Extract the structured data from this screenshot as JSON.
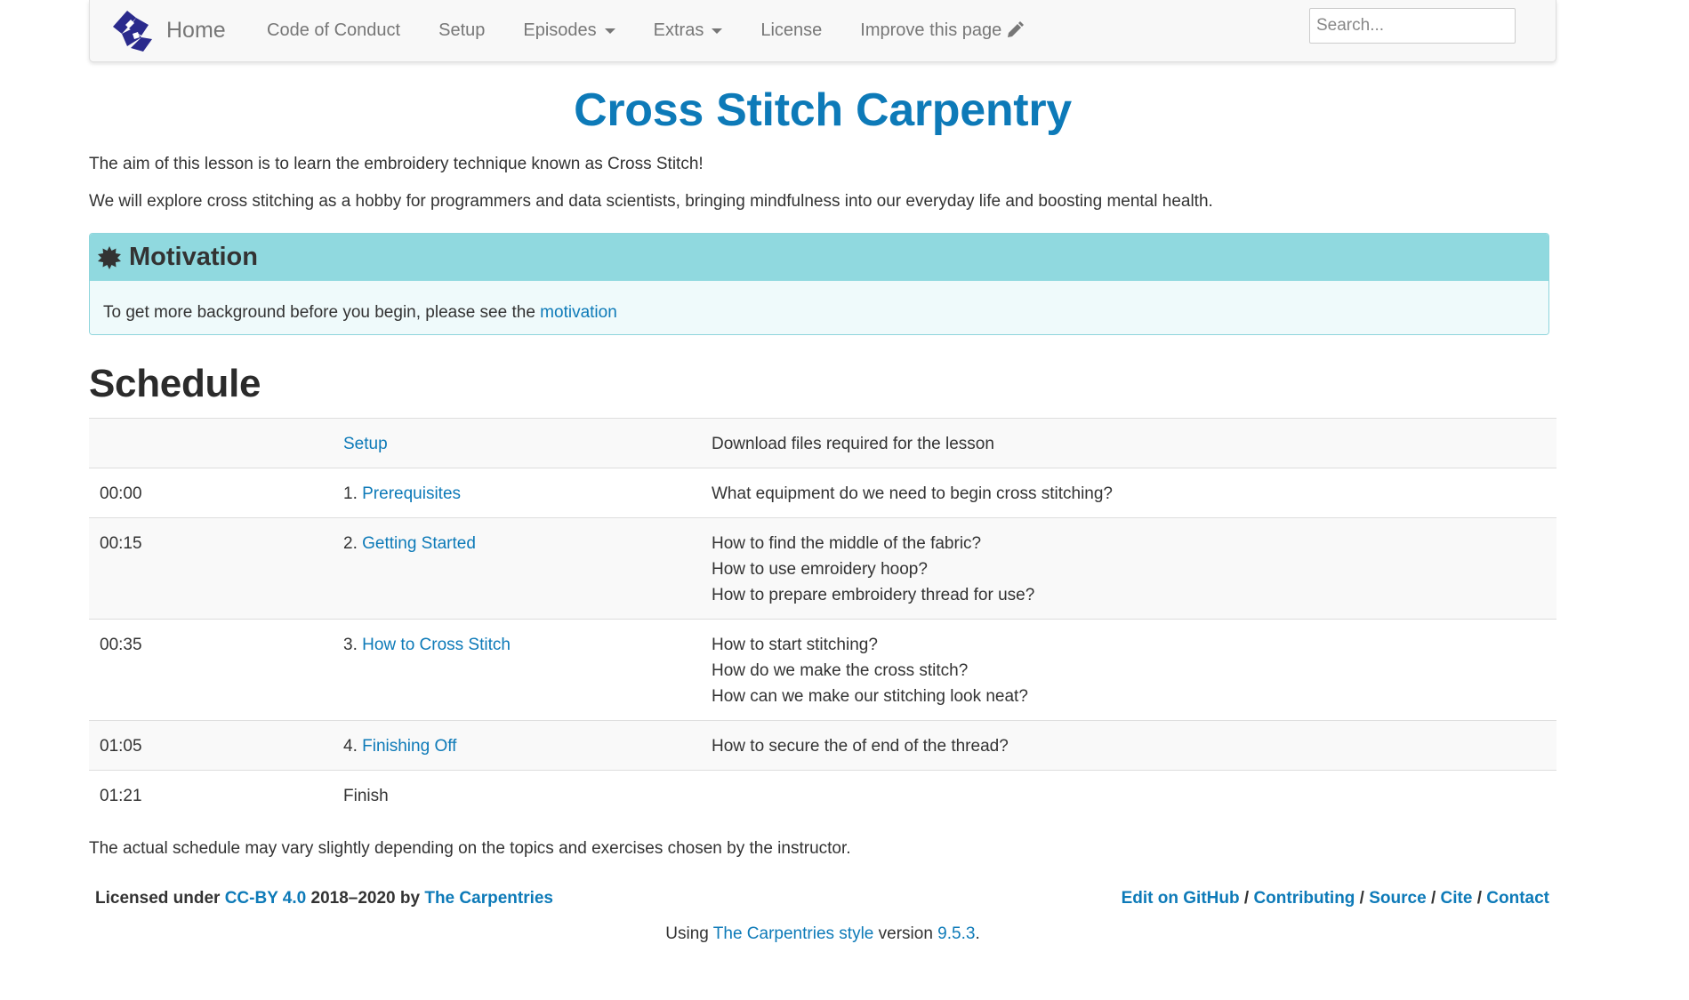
{
  "nav": {
    "brand_label": "Home",
    "items": [
      {
        "label": "Code of Conduct"
      },
      {
        "label": "Setup"
      },
      {
        "label": "Episodes"
      },
      {
        "label": "Extras"
      },
      {
        "label": "License"
      },
      {
        "label": "Improve this page"
      }
    ],
    "search_placeholder": "Search..."
  },
  "main": {
    "title": "Cross Stitch Carpentry",
    "intro": "The aim of this lesson is to learn the embroidery technique known as Cross Stitch!",
    "intro2": "We will explore cross stitching as a hobby for programmers and data scientists, bringing mindfulness into our everyday life and boosting mental health.",
    "callout": {
      "title": "Motivation",
      "body_text": "To get more background before you begin, please see the ",
      "link": "motivation"
    },
    "schedule_heading": "Schedule",
    "schedule": [
      {
        "time": "",
        "num": "",
        "episode": "Setup",
        "questions": [
          "Download files required for the lesson"
        ]
      },
      {
        "time": "00:00",
        "num": "1. ",
        "episode": "Prerequisites",
        "questions": [
          "What equipment do we need to begin cross stitching?"
        ]
      },
      {
        "time": "00:15",
        "num": "2. ",
        "episode": "Getting Started",
        "questions": [
          "How to find the middle of the fabric?",
          "How to use emroidery hoop?",
          "How to prepare embroidery thread for use?"
        ]
      },
      {
        "time": "00:35",
        "num": "3. ",
        "episode": "How to Cross Stitch",
        "questions": [
          "How to start stitching?",
          "How do we make the cross stitch?",
          "How can we make our stitching look neat?"
        ]
      },
      {
        "time": "01:05",
        "num": "4. ",
        "episode": "Finishing Off",
        "questions": [
          "How to secure the of end of the thread?"
        ]
      },
      {
        "time": "01:21",
        "num": "",
        "episode": "Finish",
        "questions": []
      }
    ],
    "note": "The actual schedule may vary slightly depending on the topics and exercises chosen by the instructor."
  },
  "footer": {
    "licensed_prefix": "Licensed under ",
    "license_link": "CC-BY 4.0",
    "years_by": " 2018–2020 by ",
    "org_link": "The Carpentries",
    "links": [
      "Edit on GitHub",
      "Contributing",
      "Source",
      "Cite",
      "Contact"
    ],
    "separator": " / ",
    "using_prefix": "Using ",
    "style_link": "The Carpentries style",
    "version_prefix": " version ",
    "version": "9.5.3",
    "period": "."
  },
  "colors": {
    "link": "#0d7ab8",
    "callout_header": "#90d9df",
    "callout_body": "#effafb",
    "logo": "#2a2a8c"
  },
  "icons": {
    "logo": "carpentries-logo-icon",
    "callout": "badge-icon",
    "improve": "pencil-icon",
    "dropdown": "caret-down-icon"
  }
}
